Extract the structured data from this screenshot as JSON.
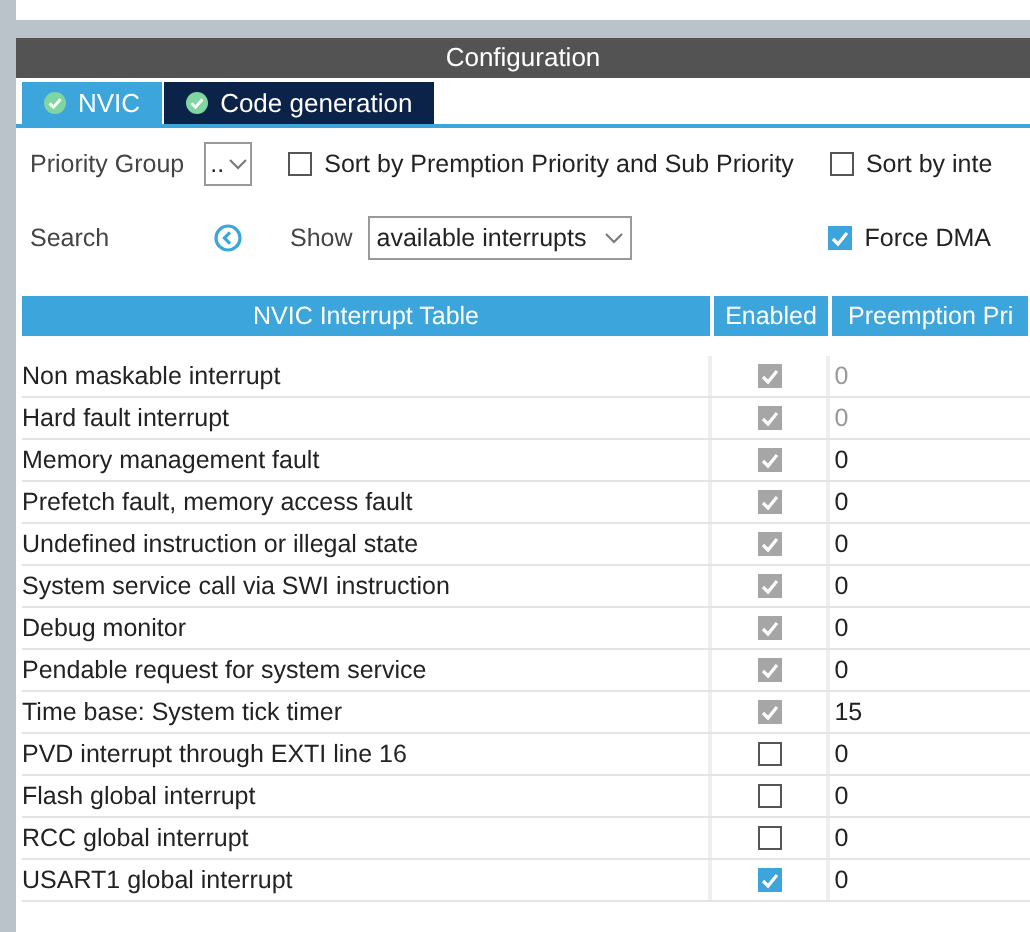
{
  "panel": {
    "title": "Configuration"
  },
  "tabs": [
    {
      "label": "NVIC",
      "selected": true
    },
    {
      "label": "Code generation",
      "selected": false
    }
  ],
  "priority_group": {
    "label": "Priority Group",
    "value": ".."
  },
  "options": [
    {
      "label": "Sort by Premption Priority and Sub Priority",
      "checked": false
    },
    {
      "label": "Sort by inte",
      "checked": false
    }
  ],
  "search": {
    "label": "Search"
  },
  "show": {
    "label": "Show",
    "value": "available interrupts"
  },
  "force_dma": {
    "label": "Force DMA",
    "checked": true
  },
  "table": {
    "columns": [
      "NVIC Interrupt Table",
      "Enabled",
      "Preemption Pri"
    ],
    "rows": [
      {
        "name": "Non maskable interrupt",
        "enabled": true,
        "locked": true,
        "priority": "0",
        "priority_disabled": true
      },
      {
        "name": "Hard fault interrupt",
        "enabled": true,
        "locked": true,
        "priority": "0",
        "priority_disabled": true
      },
      {
        "name": "Memory management fault",
        "enabled": true,
        "locked": true,
        "priority": "0",
        "priority_disabled": false
      },
      {
        "name": "Prefetch fault, memory access fault",
        "enabled": true,
        "locked": true,
        "priority": "0",
        "priority_disabled": false
      },
      {
        "name": "Undefined instruction or illegal state",
        "enabled": true,
        "locked": true,
        "priority": "0",
        "priority_disabled": false
      },
      {
        "name": "System service call via SWI instruction",
        "enabled": true,
        "locked": true,
        "priority": "0",
        "priority_disabled": false
      },
      {
        "name": "Debug monitor",
        "enabled": true,
        "locked": true,
        "priority": "0",
        "priority_disabled": false
      },
      {
        "name": "Pendable request for system service",
        "enabled": true,
        "locked": true,
        "priority": "0",
        "priority_disabled": false
      },
      {
        "name": "Time base: System tick timer",
        "enabled": true,
        "locked": true,
        "priority": "15",
        "priority_disabled": false
      },
      {
        "name": "PVD interrupt through EXTI line 16",
        "enabled": false,
        "locked": false,
        "priority": "0",
        "priority_disabled": false
      },
      {
        "name": "Flash global interrupt",
        "enabled": false,
        "locked": false,
        "priority": "0",
        "priority_disabled": false
      },
      {
        "name": "RCC global interrupt",
        "enabled": false,
        "locked": false,
        "priority": "0",
        "priority_disabled": false
      },
      {
        "name": "USART1 global interrupt",
        "enabled": true,
        "locked": false,
        "priority": "0",
        "priority_disabled": false
      }
    ]
  }
}
